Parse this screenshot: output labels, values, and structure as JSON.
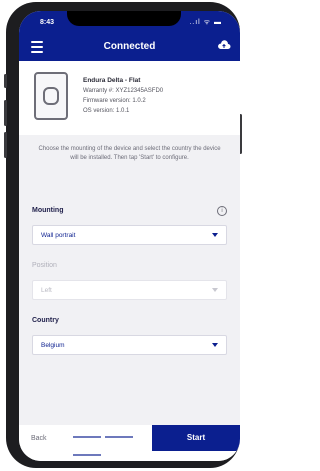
{
  "status_bar": {
    "time": "8:43",
    "indicators": "..ıl ᯤ ▬"
  },
  "app_bar": {
    "title": "Connected"
  },
  "device": {
    "name": "Endura Delta - Flat",
    "warranty": "Warranty #: XYZ12345ASFD0",
    "firmware": "Firmware version: 1.0.2",
    "os": "OS version: 1.0.1"
  },
  "instructions": "Choose the mounting of the device and select the country the device will be installed. Then tap 'Start' to configure.",
  "form": {
    "mounting_label": "Mounting",
    "mounting_value": "Wall portrait",
    "position_label": "Position",
    "position_value": "Left",
    "country_label": "Country",
    "country_value": "Belgium"
  },
  "footer": {
    "back_label": "Back",
    "start_label": "Start"
  },
  "colors": {
    "primary": "#0b1f8f",
    "background": "#f1f1f4"
  }
}
